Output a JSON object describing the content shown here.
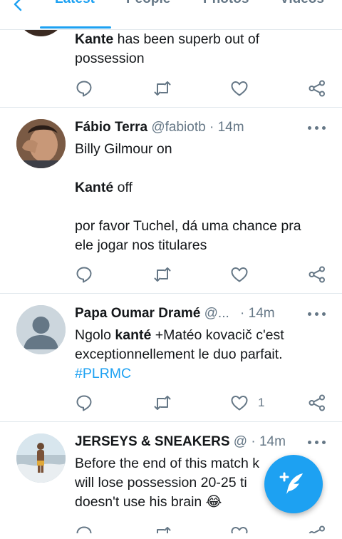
{
  "tabs": [
    {
      "label": "Latest",
      "active": true
    },
    {
      "label": "People",
      "active": false
    },
    {
      "label": "Photos",
      "active": false
    },
    {
      "label": "Videos",
      "active": false
    }
  ],
  "tweets": [
    {
      "body_bold": "Kante",
      "body_rest": " has been superb out of",
      "body_line2": "possession"
    },
    {
      "name": "Fábio Terra",
      "handle": "@fabiotb",
      "separator": "·",
      "time": "14m",
      "line1": "Billy Gilmour on",
      "line2_bold": "Kanté",
      "line2_rest": " off",
      "line3": "por favor Tuchel, dá uma chance pra",
      "line4": "ele jogar nos titulares"
    },
    {
      "name": "Papa Oumar Dramé",
      "handle": "@...",
      "separator": "·",
      "time": "14m",
      "line1_pre": "Ngolo ",
      "line1_bold": "kanté",
      "line1_post": " +Matéo kovacič c'est",
      "line2": "exceptionnellement le duo parfait.",
      "hashtag": "#PLRMC",
      "like_count": "1"
    },
    {
      "name": "JERSEYS & SNEAKERS",
      "handle": "@",
      "separator": "·",
      "time": "14m",
      "line1": "Before the end of this match k",
      "line2": "will lose possession 20-25 ti",
      "line3": "doesn't use his brain 😂"
    }
  ],
  "colors": {
    "accent": "#1da1f2",
    "text": "#14171a",
    "secondary": "#657786",
    "divider": "#e1e8ed"
  },
  "icons": {
    "back": "back-arrow-icon",
    "reply": "reply-icon",
    "retweet": "retweet-icon",
    "like": "heart-icon",
    "share": "share-icon",
    "more": "more-icon",
    "compose": "compose-icon"
  }
}
